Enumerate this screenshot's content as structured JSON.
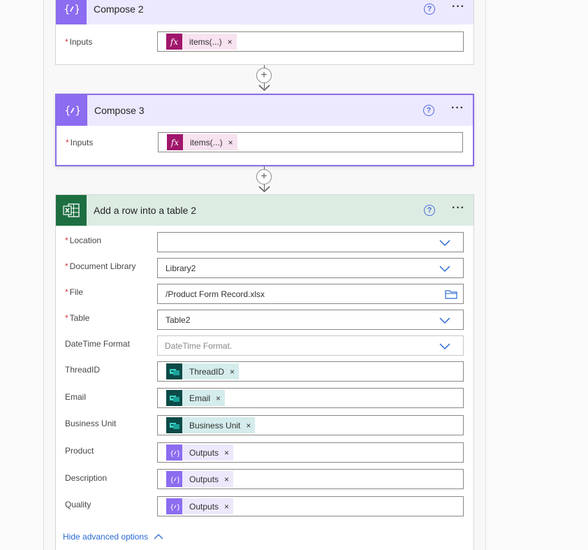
{
  "compose2": {
    "title": "Compose 2",
    "inputs_label": "Inputs",
    "token_label": "items(...)",
    "token_remove": "×"
  },
  "compose3": {
    "title": "Compose 3",
    "inputs_label": "Inputs",
    "token_label": "items(...)",
    "token_remove": "×"
  },
  "add_row": {
    "title": "Add a row into a table 2",
    "location_label": "Location",
    "location_value": "",
    "document_library_label": "Document Library",
    "document_library_value": "Library2",
    "file_label": "File",
    "file_value": "/Product Form Record.xlsx",
    "table_label": "Table",
    "table_value": "Table2",
    "datetime_label": "DateTime Format",
    "datetime_placeholder": "DateTime Format.",
    "threadid_label": "ThreadID",
    "threadid_token": "ThreadID",
    "email_label": "Email",
    "email_token": "Email",
    "business_unit_label": "Business Unit",
    "business_unit_token": "Business Unit",
    "product_label": "Product",
    "product_token": "Outputs",
    "description_label": "Description",
    "description_token": "Outputs",
    "quality_label": "Quality",
    "quality_token": "Outputs",
    "token_remove": "×",
    "hide_advanced": "Hide advanced options"
  },
  "common": {
    "required_marker": "*",
    "help_glyph": "?",
    "more_glyph": "···",
    "plus_glyph": "+"
  },
  "colors": {
    "compose_accent": "#8c6cf0",
    "excel_accent": "#1d6f42",
    "fx_token": "#a0166b",
    "dynamic_token": "#0d4b48",
    "link": "#2a6ad0"
  }
}
